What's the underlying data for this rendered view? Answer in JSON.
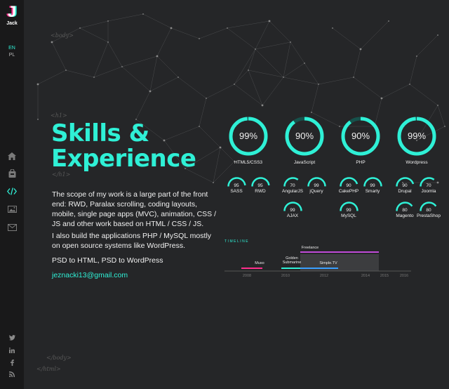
{
  "sidebar": {
    "logo_letter": "J",
    "logo_name": "Jack",
    "lang_en": "EN",
    "lang_pl": "PL",
    "nav_items": [
      "home-icon",
      "bag-icon",
      "code-icon",
      "image-icon",
      "mail-icon"
    ],
    "social": [
      "twitter-icon",
      "linkedin-icon",
      "facebook-icon",
      "rss-icon"
    ]
  },
  "tags": {
    "body_open": "<body>",
    "h1_open": "<h1>",
    "h1_close": "</h1>",
    "body_close": "</body>",
    "html_close": "</html>"
  },
  "main": {
    "title_line1": "Skills &",
    "title_line2": "Experience",
    "paragraph1": "The scope of my work is a large part of the front end: RWD, Paralax scrolling, coding layouts, mobile, single page apps (MVC), animation, CSS / JS and other work based on HTML / CSS / JS.",
    "paragraph2": "I also build the applications PHP / MySQL mostly on open source systems like WordPress.",
    "paragraph3": "PSD to HTML, PSD to WordPress",
    "email": "jeznacki13@gmail.com"
  },
  "skills": {
    "major": [
      {
        "label": "HTML5/CSS3",
        "value": "99%"
      },
      {
        "label": "JavaScript",
        "value": "90%"
      },
      {
        "label": "PHP",
        "value": "90%"
      },
      {
        "label": "Wordpress",
        "value": "99%"
      }
    ],
    "minor": [
      {
        "label": "SASS",
        "value": "95"
      },
      {
        "label": "RWD",
        "value": "95"
      },
      {
        "label": "AngularJS",
        "value": "70"
      },
      {
        "label": "jQuery",
        "value": "99"
      },
      {
        "label": "CakePHP",
        "value": "90"
      },
      {
        "label": "Smarty",
        "value": "99"
      },
      {
        "label": "Drupal",
        "value": "90"
      },
      {
        "label": "Joomla",
        "value": "70"
      },
      {
        "label": "AJAX",
        "value": "99"
      },
      {
        "label": "MySQL",
        "value": "99"
      },
      {
        "label": "Magento",
        "value": "80"
      },
      {
        "label": "PrestaShop",
        "value": "80"
      }
    ]
  },
  "timeline": {
    "title": "TIMELINE",
    "years": [
      "2008",
      "2010",
      "2012",
      "2014",
      "2015",
      "2016"
    ],
    "entries": [
      {
        "label": "Muso",
        "color": "#ff2e8c"
      },
      {
        "label": "Golden Submarine",
        "color": "#2ff0d6"
      },
      {
        "label": "Simple.TV",
        "color": "#3aa0ff"
      },
      {
        "label": "Freelance",
        "color": "#c04bd8"
      }
    ]
  },
  "colors": {
    "accent": "#2ff0d6",
    "bg": "#252628",
    "sidebar": "#19191a"
  }
}
